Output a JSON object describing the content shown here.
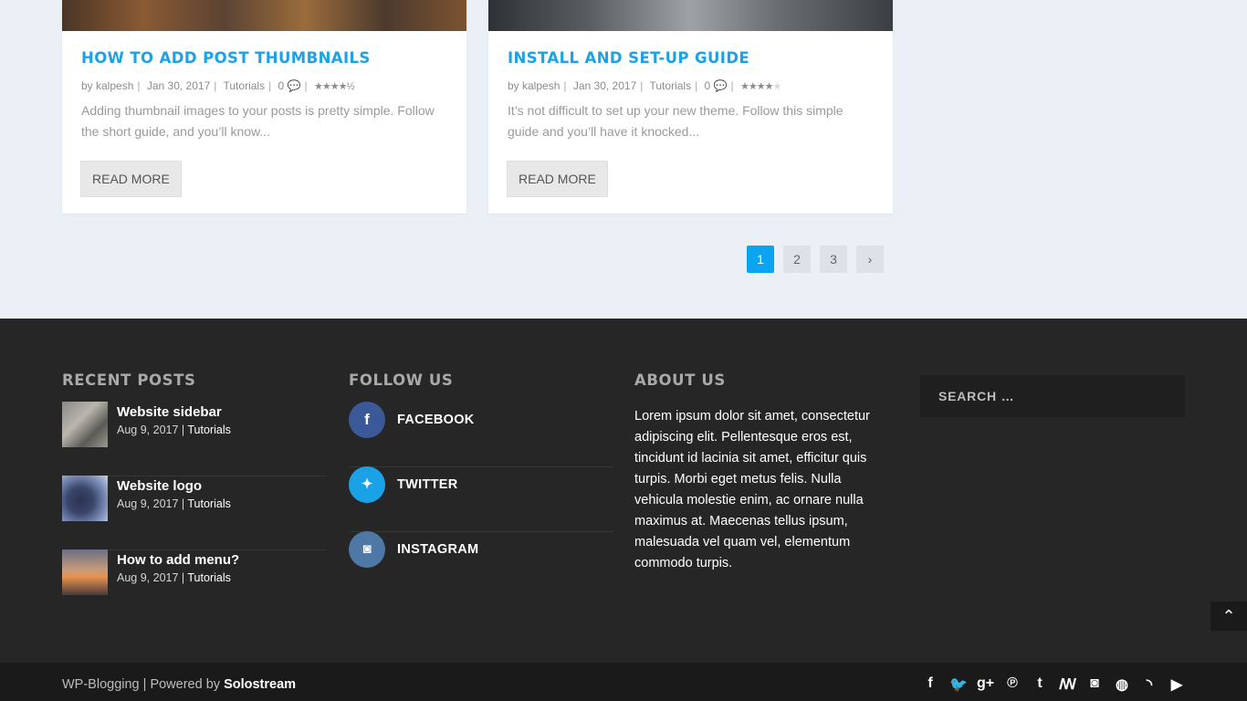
{
  "posts": [
    {
      "title": "HOW TO ADD POST THUMBNAILS",
      "author": "by kalpesh",
      "date": "Jan 30, 2017",
      "category": "Tutorials",
      "comments": "0",
      "rating": 4.5,
      "excerpt": "Adding thumbnail images to your posts is pretty simple. Follow the short guide, and you’ll know...",
      "read_more": "READ MORE"
    },
    {
      "title": "INSTALL AND SET-UP GUIDE",
      "author": "by kalpesh",
      "date": "Jan 30, 2017",
      "category": "Tutorials",
      "comments": "0",
      "rating": 4,
      "excerpt": "It’s not difficult to set up your new theme. Follow this simple guide and you’ll have it knocked...",
      "read_more": "READ MORE"
    }
  ],
  "pagination": {
    "pages": [
      "1",
      "2",
      "3"
    ],
    "current": "1",
    "next": "›"
  },
  "footer": {
    "recent_title": "RECENT POSTS",
    "recent": [
      {
        "title": "Website sidebar",
        "date": "Aug 9, 2017",
        "category": "Tutorials"
      },
      {
        "title": "Website logo",
        "date": "Aug 9, 2017",
        "category": "Tutorials"
      },
      {
        "title": "How to add menu?",
        "date": "Aug 9, 2017",
        "category": "Tutorials"
      }
    ],
    "follow_title": "FOLLOW US",
    "follow": [
      {
        "label": "FACEBOOK",
        "icon": "facebook-icon",
        "glyph": "f",
        "color": "#3b5998"
      },
      {
        "label": "TWITTER",
        "icon": "twitter-icon",
        "glyph": "🐦",
        "color": "#1ba1e6"
      },
      {
        "label": "INSTAGRAM",
        "icon": "instagram-icon",
        "glyph": "◘",
        "color": "#4e79a6"
      }
    ],
    "about_title": "ABOUT US",
    "about_text": "Lorem ipsum dolor sit amet, consectetur adipiscing elit. Pellentesque eros est, tincidunt id lacinia sit amet, efficitur quis turpis. Morbi eget metus felis. Nulla vehicula molestie enim, ac ornare nulla maximus at. Maecenas tellus ipsum, malesuada vel quam vel, elementum commodo turpis.",
    "search_placeholder": "SEARCH …"
  },
  "bottom": {
    "site": "WP-Blogging",
    "separator": " | Powered by ",
    "powered_by": "Solostream",
    "social": [
      "facebook-icon",
      "twitter-icon",
      "google-plus-icon",
      "pinterest-icon",
      "tumblr-icon",
      "stumbleupon-icon",
      "instagram-icon",
      "dribbble-icon",
      "rss-icon",
      "youtube-icon"
    ]
  }
}
